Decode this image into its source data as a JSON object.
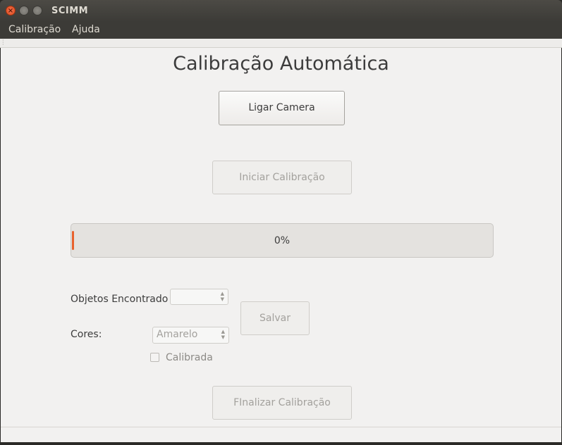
{
  "window": {
    "title": "SCIMM"
  },
  "menu": {
    "items": [
      "Calibração",
      "Ajuda"
    ]
  },
  "heading": "Calibração Automática",
  "buttons": {
    "ligar_camera": "Ligar Camera",
    "iniciar_calibracao": "Iniciar Calibração",
    "salvar": "Salvar",
    "finalizar_calibracao": "FInalizar Calibração"
  },
  "progress": {
    "value": 0,
    "text": "0%"
  },
  "form": {
    "objetos_label": "Objetos Encontrado",
    "objetos_value": "",
    "cores_label": "Cores:",
    "cores_value": "Amarelo",
    "calibrada_label": "Calibrada",
    "calibrada_checked": false
  },
  "colors": {
    "accent": "#e8622e",
    "titlebar": "#3c3b37",
    "background": "#f2f1f0"
  }
}
